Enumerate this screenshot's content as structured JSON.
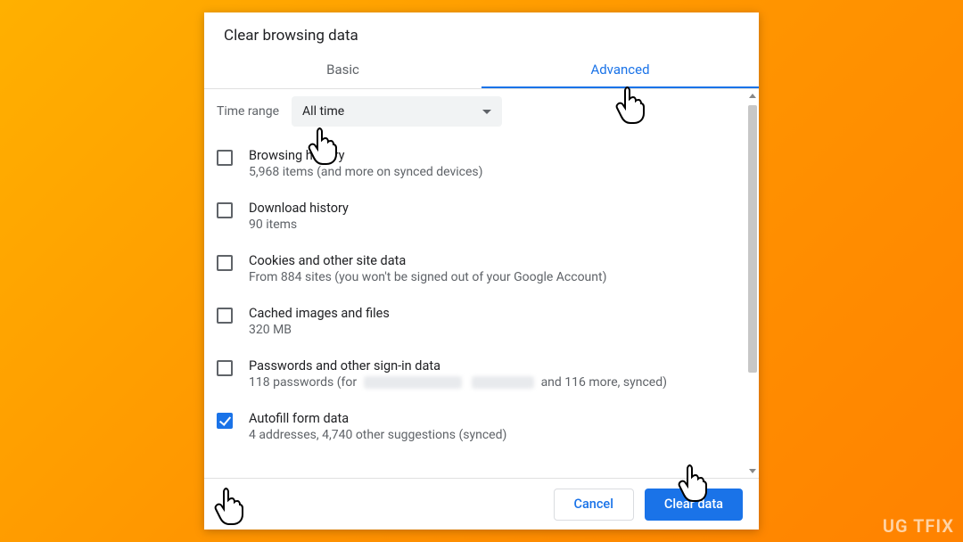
{
  "dialog": {
    "title": "Clear browsing data",
    "tabs": {
      "basic": "Basic",
      "advanced": "Advanced"
    },
    "time_range": {
      "label": "Time range",
      "value": "All time"
    },
    "items": [
      {
        "checked": false,
        "title": "Browsing history",
        "sub": "5,968 items (and more on synced devices)"
      },
      {
        "checked": false,
        "title": "Download history",
        "sub": "90 items"
      },
      {
        "checked": false,
        "title": "Cookies and other site data",
        "sub": "From 884 sites (you won't be signed out of your Google Account)"
      },
      {
        "checked": false,
        "title": "Cached images and files",
        "sub": "320 MB"
      },
      {
        "checked": false,
        "title": "Passwords and other sign-in data",
        "sub_prefix": "118 passwords (for",
        "sub_suffix": "and 116 more, synced)"
      },
      {
        "checked": true,
        "title": "Autofill form data",
        "sub": "4 addresses, 4,740 other suggestions (synced)"
      }
    ],
    "buttons": {
      "cancel": "Cancel",
      "clear": "Clear data"
    }
  },
  "watermark": "UG   TFIX"
}
